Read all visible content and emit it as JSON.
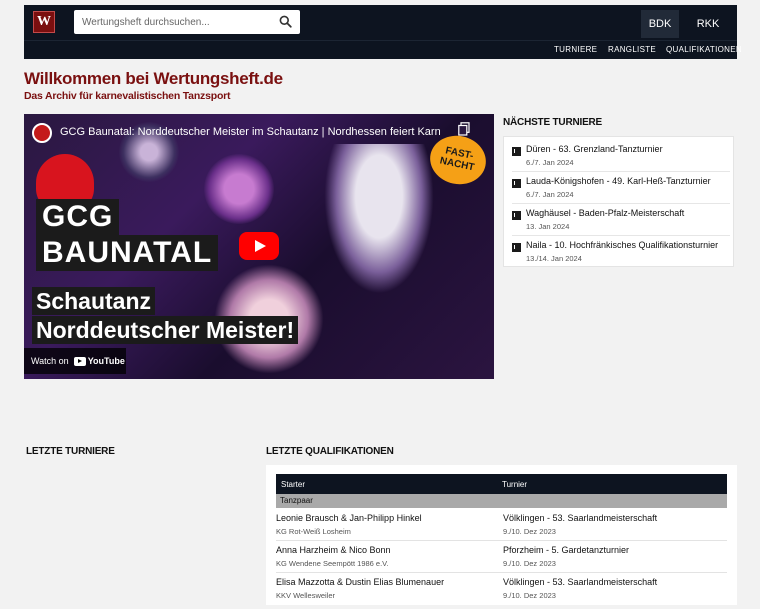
{
  "header": {
    "logo_letter": "W",
    "search_placeholder": "Wertungsheft durchsuchen...",
    "bdk_label": "BDK",
    "rkk_label": "RKK",
    "nav": [
      "TURNIERE",
      "RANGLISTE",
      "QUALIFIKATIONEN"
    ]
  },
  "page": {
    "title": "Willkommen bei Wertungsheft.de",
    "subtitle": "Das Archiv für karnevalistischen Tanzsport"
  },
  "video": {
    "title": "GCG Baunatal: Norddeutscher Meister im Schautanz | Nordhessen feiert Karne...",
    "share_label": "Link",
    "line1": "GCG",
    "line2": "BAUNATAL",
    "line3": "Schautanz",
    "line4": "Norddeutscher Meister!",
    "badge": "FAST-NACHT",
    "watch_on": "Watch on",
    "yt_label": "YouTube"
  },
  "next_tournaments": {
    "heading": "NÄCHSTE TURNIERE",
    "items": [
      {
        "name": "Düren - 63. Grenzland-Tanzturnier",
        "date": "6./7. Jan 2024"
      },
      {
        "name": "Lauda-Königshofen - 49. Karl-Heß-Tanzturnier",
        "date": "6./7. Jan 2024"
      },
      {
        "name": "Waghäusel - Baden-Pfalz-Meisterschaft",
        "date": "13. Jan 2024"
      },
      {
        "name": "Naila - 10. Hochfränkisches Qualifikationsturnier",
        "date": "13./14. Jan 2024"
      }
    ]
  },
  "last_tournaments": {
    "heading": "LETZTE TURNIERE"
  },
  "last_qualifications": {
    "heading": "LETZTE QUALIFIKATIONEN",
    "col_starter": "Starter",
    "col_turnier": "Turnier",
    "group": "Tanzpaar",
    "rows": [
      {
        "starter": "Leonie Brausch & Jan-Philipp Hinkel",
        "club": "KG Rot-Weiß Losheim",
        "turnier": "Völklingen - 53. Saarlandmeisterschaft",
        "date": "9./10. Dez 2023"
      },
      {
        "starter": "Anna Harzheim & Nico Bonn",
        "club": "KG Wendene Seempött 1986 e.V.",
        "turnier": "Pforzheim - 5. Gardetanzturnier",
        "date": "9./10. Dez 2023"
      },
      {
        "starter": "Elisa Mazzotta & Dustin Elias Blumenauer",
        "club": "KKV Wellesweiler",
        "turnier": "Völklingen - 53. Saarlandmeisterschaft",
        "date": "9./10. Dez 2023"
      }
    ]
  }
}
